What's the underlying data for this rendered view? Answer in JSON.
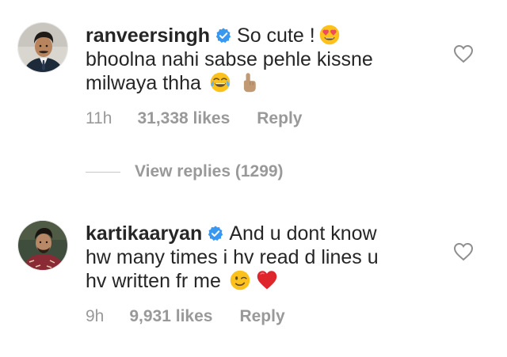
{
  "comments": [
    {
      "username": "ranveersingh",
      "verified": true,
      "text_line1": "So cute !",
      "text_line2": "bhoolna nahi sabse pehle kissne",
      "text_line3": "milwaya thha",
      "emojis": [
        "heart-eyes-emoji",
        "tears-of-joy-emoji",
        "index-pointing-up-emoji"
      ],
      "time": "11h",
      "likes": "31,338 likes",
      "reply_label": "Reply"
    },
    {
      "username": "kartikaaryan",
      "verified": true,
      "text_line1": "And u dont know",
      "text_line2": "hw many times i hv read d lines u",
      "text_line3": "hv written fr me",
      "emojis": [
        "winking-face-emoji",
        "red-heart-emoji"
      ],
      "time": "9h",
      "likes": "9,931 likes",
      "reply_label": "Reply"
    }
  ],
  "view_replies": "View replies (1299)",
  "colors": {
    "text": "#262626",
    "meta": "#999999",
    "verified": "#3897f0",
    "divider": "#c7c7c7"
  }
}
